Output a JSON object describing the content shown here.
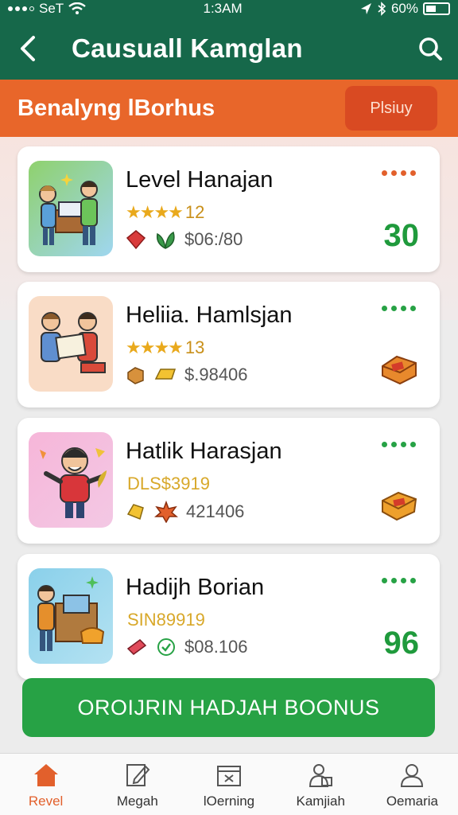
{
  "status": {
    "carrier": "SeT",
    "time": "1:3AM",
    "battery": "60%"
  },
  "header": {
    "title": "Causuall Kamglan"
  },
  "bonus_bar": {
    "title": "Benalyng lBorhus",
    "button": "Plsiuy"
  },
  "cards": [
    {
      "title": "Level Hanajan",
      "rating": "12",
      "price": "$06:/80",
      "score": "30",
      "dots_color": "#e2602c"
    },
    {
      "title": "Heliia. Hamlsjan",
      "rating": "13",
      "price": "$.98406",
      "dots_color": "#27a245"
    },
    {
      "title": "Hatlik Harasjan",
      "rating": "DLS$3919",
      "price": "421406",
      "dots_color": "#27a245"
    },
    {
      "title": "Hadijh Borian",
      "rating": "SIN89919",
      "price": "$08.106",
      "score": "96",
      "dots_color": "#27a245"
    }
  ],
  "cta": {
    "label": "OROIJRIN HADJAH BOONUS"
  },
  "tabs": [
    {
      "label": "Revel",
      "icon": "home-icon",
      "active": true
    },
    {
      "label": "Megah",
      "icon": "edit-icon",
      "active": false
    },
    {
      "label": "lOerning",
      "icon": "box-icon",
      "active": false
    },
    {
      "label": "Kamjiah",
      "icon": "person-lock-icon",
      "active": false
    },
    {
      "label": "Oemaria",
      "icon": "profile-icon",
      "active": false
    }
  ],
  "colors": {
    "header": "#16684a",
    "bonus": "#e8662a",
    "accent_green": "#27a245",
    "accent_orange": "#e2602c"
  }
}
